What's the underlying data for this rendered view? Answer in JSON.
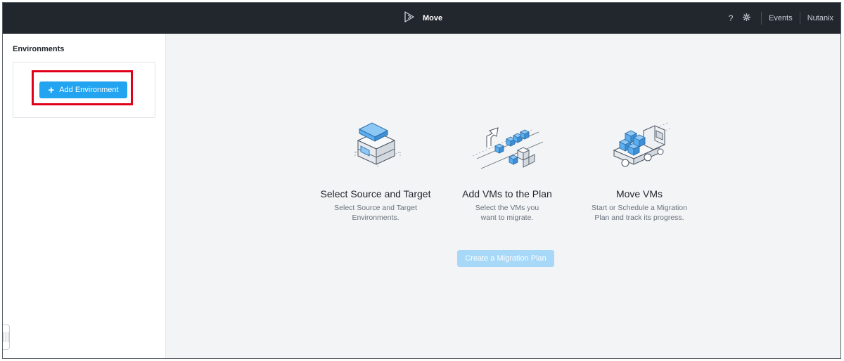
{
  "topbar": {
    "app_name": "Move",
    "help_icon": "question-icon",
    "settings_icon": "gear-icon",
    "events_label": "Events",
    "account_label": "Nutanix"
  },
  "sidebar": {
    "title": "Environments",
    "add_button_label": "Add Environment",
    "add_button_icon": "plus-icon"
  },
  "steps": [
    {
      "icon": "source-target-icon",
      "title": "Select Source and Target",
      "description_lines": [
        "Select Source and Target",
        "Environments."
      ]
    },
    {
      "icon": "add-vms-icon",
      "title": "Add VMs to the Plan",
      "description_lines": [
        "Select the VMs you",
        "want to migrate."
      ]
    },
    {
      "icon": "move-vms-truck-icon",
      "title": "Move VMs",
      "description_lines": [
        "Start or Schedule a Migration",
        "Plan and track its progress."
      ]
    }
  ],
  "create_plan_button": {
    "label": "Create a Migration Plan",
    "state": "disabled"
  },
  "colors": {
    "topbar_bg": "#22272e",
    "primary_button": "#22a4f1",
    "disabled_button": "#a7d8f8",
    "highlight_box": "#e0001a",
    "main_bg": "#f2f4f6",
    "illustration_blue": "#5aaef0"
  }
}
